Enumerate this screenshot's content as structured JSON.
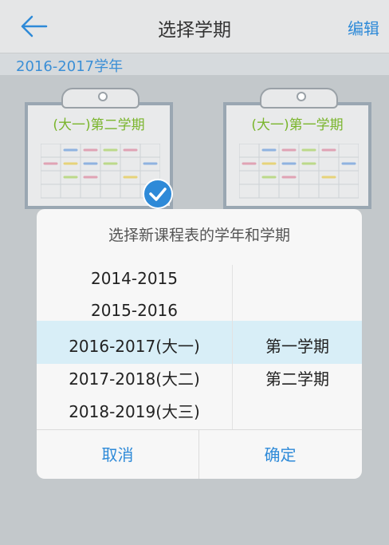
{
  "header": {
    "title": "选择学期",
    "edit_label": "编辑"
  },
  "year_bar": {
    "label": "2016-2017学年"
  },
  "cards": [
    {
      "title": "(大一)第二学期",
      "selected": true
    },
    {
      "title": "(大一)第一学期",
      "selected": false
    }
  ],
  "dialog": {
    "title": "选择新课程表的学年和学期",
    "years": [
      "2014-2015",
      "2015-2016",
      "2016-2017(大一)",
      "2017-2018(大二)",
      "2018-2019(大三)"
    ],
    "terms": [
      "第一学期",
      "第二学期"
    ],
    "cancel_label": "取消",
    "confirm_label": "确定"
  },
  "colors": {
    "accent": "#2e8ad8",
    "card_title": "#7ab52c",
    "highlight": "#d8eef7"
  }
}
